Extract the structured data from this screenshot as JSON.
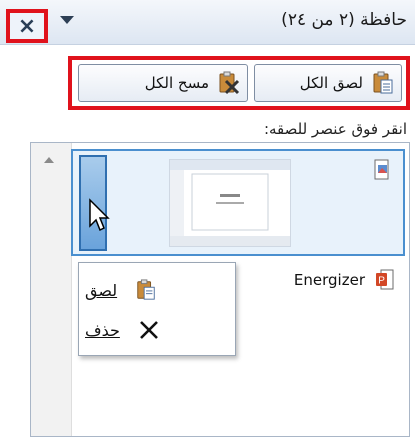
{
  "header": {
    "title": "حافظة (٢ من ٢٤)",
    "close_symbol": "×"
  },
  "toolbar": {
    "paste_all_label": "لصق الكل",
    "clear_all_label": "مسح الكل"
  },
  "instruction": "انقر فوق عنصر للصقه:",
  "items": [
    {
      "type": "image",
      "label": ""
    },
    {
      "type": "powerpoint-text",
      "label": "Energizer"
    }
  ],
  "context_menu": {
    "items": [
      {
        "label": "لصق",
        "icon": "paste-icon"
      },
      {
        "label": "حذف",
        "icon": "delete-x-icon"
      }
    ]
  },
  "colors": {
    "highlight_border": "#e0121c",
    "selection_blue": "#4a8fcf"
  }
}
